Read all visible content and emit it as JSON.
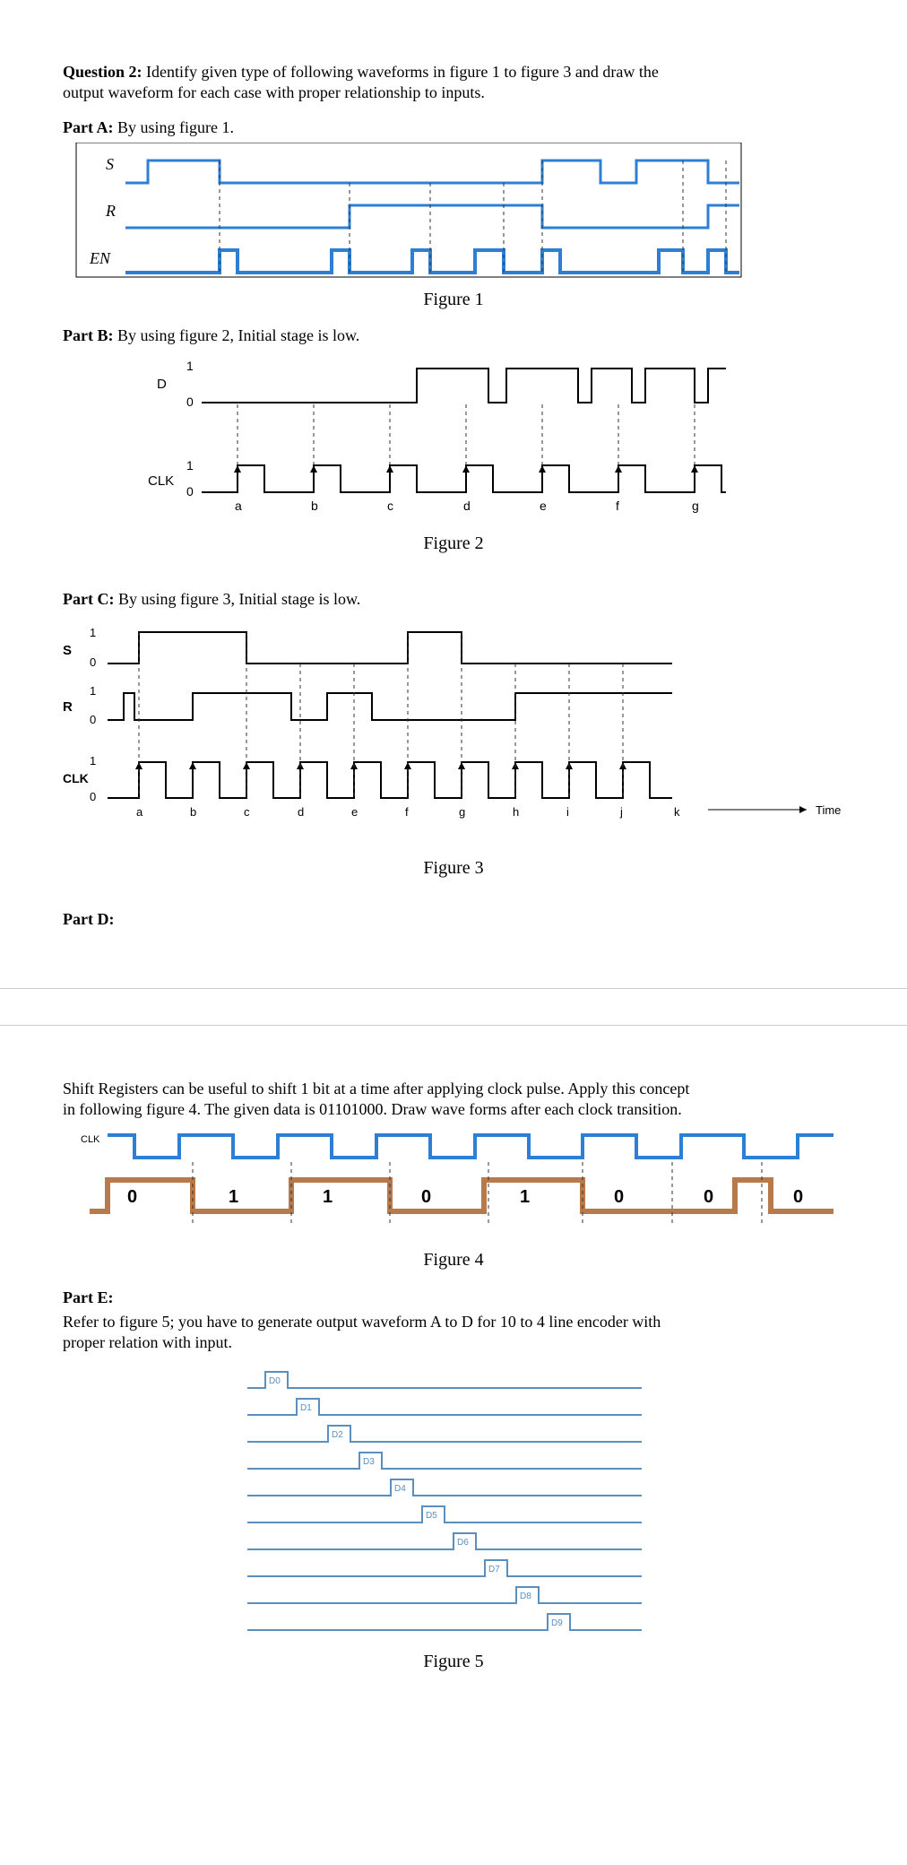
{
  "q": {
    "num": "Question 2:",
    "text1": " Identify given type of following waveforms in figure 1 to figure 3 and draw the",
    "text2": "output waveform for each case with proper relationship to inputs."
  },
  "partA": {
    "label": "Part A:",
    "text": " By using figure 1."
  },
  "fig1": {
    "caption": "Figure 1",
    "labels": [
      "S",
      "R",
      "EN"
    ]
  },
  "partB": {
    "label": "Part B:",
    "text": " By using figure 2, Initial stage is low."
  },
  "fig2": {
    "caption": "Figure 2",
    "labels": [
      "D",
      "CLK"
    ],
    "ticks": [
      "a",
      "b",
      "c",
      "d",
      "e",
      "f",
      "g"
    ],
    "vals": [
      "1",
      "0",
      "1",
      "0"
    ]
  },
  "partC": {
    "label": "Part C:",
    "text": " By using figure 3, Initial stage is low."
  },
  "fig3": {
    "caption": "Figure 3",
    "labels": [
      "S",
      "R",
      "CLK"
    ],
    "ticks": [
      "a",
      "b",
      "c",
      "d",
      "e",
      "f",
      "g",
      "h",
      "i",
      "j",
      "k"
    ],
    "time": "Time",
    "vals": [
      "1",
      "0",
      "1",
      "0",
      "1",
      "0"
    ]
  },
  "partD": {
    "label": "Part D:"
  },
  "partDtext1": "Shift Registers can be useful to shift 1 bit at a time after applying clock pulse. Apply this concept",
  "partDtext2": "in following figure 4. The given data is 01101000.  Draw wave forms after each clock transition.",
  "fig4": {
    "caption": "Figure 4",
    "clk": "CLK",
    "bits": [
      "0",
      "1",
      "1",
      "0",
      "1",
      "0",
      "0",
      "0"
    ]
  },
  "partE": {
    "label": "Part E:",
    "text1": "Refer to figure 5; you have to generate output waveform A to D for 10 to 4 line encoder with",
    "text2": "proper relation with input."
  },
  "fig5": {
    "caption": "Figure 5",
    "labels": [
      "D0",
      "D1",
      "D2",
      "D3",
      "D4",
      "D5",
      "D6",
      "D7",
      "D8",
      "D9"
    ]
  }
}
